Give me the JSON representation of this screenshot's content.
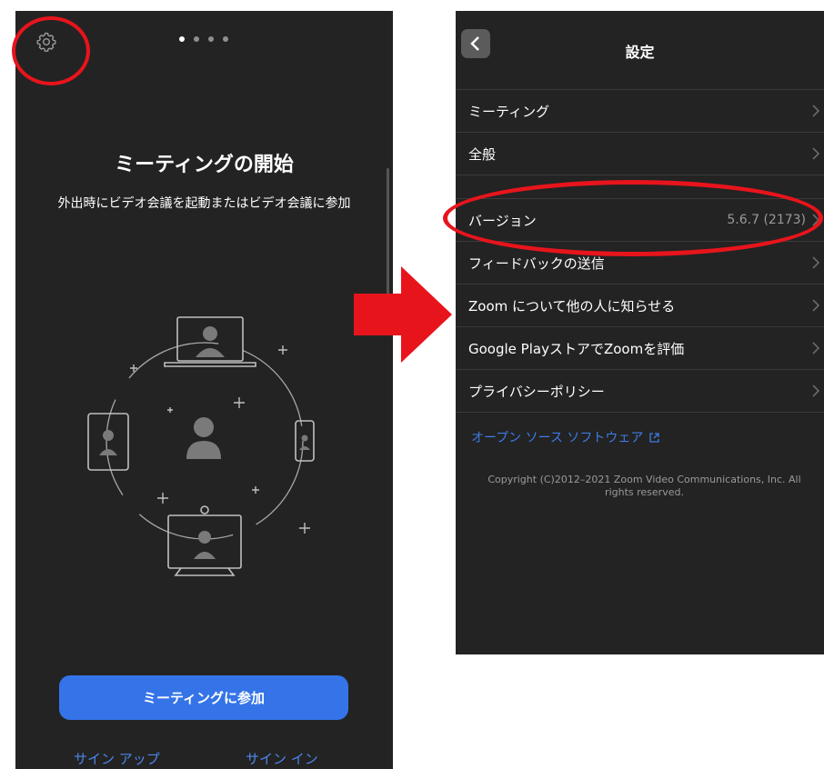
{
  "left": {
    "title": "ミーティングの開始",
    "subtitle": "外出時にビデオ会議を起動またはビデオ会議に参加",
    "join_button": "ミーティングに参加",
    "signup": "サイン アップ",
    "signin": "サイン イン",
    "page_dots": 4,
    "active_dot": 1
  },
  "right": {
    "title": "設定",
    "group1": [
      {
        "label": "ミーティング"
      },
      {
        "label": "全般"
      }
    ],
    "group2": [
      {
        "label": "バージョン",
        "value": "5.6.7 (2173)"
      },
      {
        "label": "フィードバックの送信"
      },
      {
        "label": "Zoom について他の人に知らせる"
      },
      {
        "label": "Google PlayストアでZoomを評価"
      },
      {
        "label": "プライバシーポリシー"
      }
    ],
    "open_source": "オープン ソース ソフトウェア",
    "copyright": "Copyright (C)2012–2021 Zoom Video Communications, Inc. All rights reserved."
  },
  "colors": {
    "background": "#232323",
    "accent": "#3574e8",
    "highlight": "#e8141c"
  },
  "icons": [
    "gear-icon",
    "chevron-left-icon",
    "chevron-right-icon",
    "external-link-icon",
    "red-arrow"
  ]
}
